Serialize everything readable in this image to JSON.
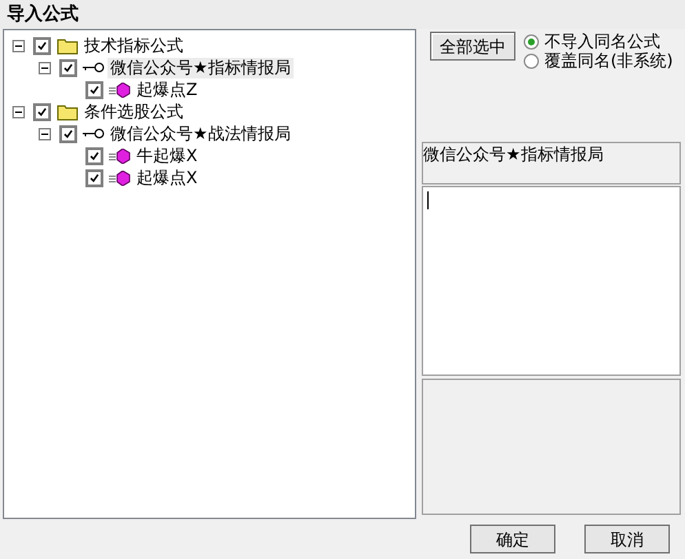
{
  "window": {
    "title": "导入公式"
  },
  "tree": [
    {
      "kind": "folder",
      "label": "技术指标公式",
      "checked": true,
      "expanded": true,
      "selected": false,
      "children": [
        {
          "kind": "group",
          "label": "微信公众号★指标情报局",
          "checked": true,
          "expanded": true,
          "selected": true,
          "children": [
            {
              "kind": "formula",
              "label": "起爆点Z",
              "checked": true,
              "selected": false
            }
          ]
        }
      ]
    },
    {
      "kind": "folder",
      "label": "条件选股公式",
      "checked": true,
      "expanded": true,
      "selected": false,
      "children": [
        {
          "kind": "group",
          "label": "微信公众号★战法情报局",
          "checked": true,
          "expanded": true,
          "selected": false,
          "children": [
            {
              "kind": "formula",
              "label": "牛起爆X",
              "checked": true,
              "selected": false
            },
            {
              "kind": "formula",
              "label": "起爆点X",
              "checked": true,
              "selected": false
            }
          ]
        }
      ]
    }
  ],
  "select_all_button": "全部选中",
  "options": [
    {
      "label": "不导入同名公式",
      "selected": true
    },
    {
      "label": "覆盖同名(非系统)",
      "selected": false
    }
  ],
  "name_field": {
    "value": "微信公众号★指标情报局"
  },
  "buttons": [
    "确定",
    "取消"
  ]
}
